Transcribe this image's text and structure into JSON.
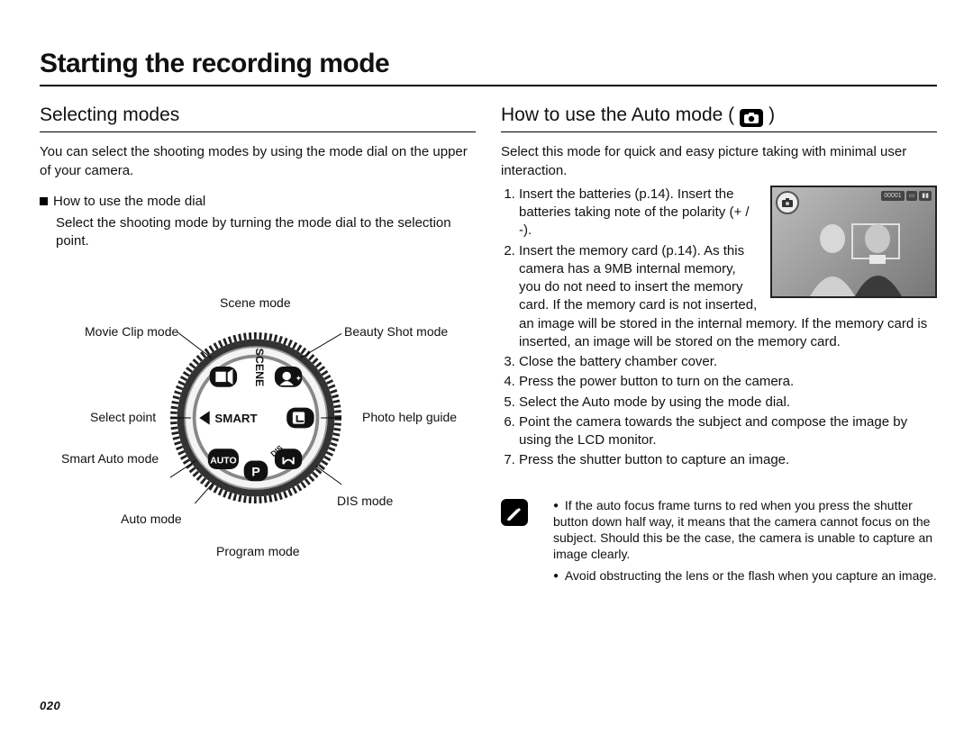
{
  "title": "Starting the recording mode",
  "pageNumber": "020",
  "left": {
    "heading": "Selecting modes",
    "intro": "You can select the shooting modes by using the mode dial on the upper of your camera.",
    "dialLabelTitle": "How to use the mode dial",
    "dialLabelBody": "Select the shooting mode by turning the mode dial to the selection point.",
    "labels": {
      "scene": "Scene mode",
      "movie": "Movie Clip mode",
      "beauty": "Beauty Shot mode",
      "select": "Select point",
      "photoHelp": "Photo help guide",
      "smart": "Smart Auto mode",
      "dis": "DIS mode",
      "auto": "Auto mode",
      "program": "Program mode"
    },
    "dialText": {
      "scene": "SCENE",
      "smart": "SMART",
      "auto": "AUTO",
      "dis": "DIS",
      "p": "P"
    }
  },
  "right": {
    "heading": "How to use the Auto mode (",
    "headingClose": ")",
    "intro": "Select this mode for quick and easy picture taking with minimal user interaction.",
    "steps": [
      "Insert the batteries (p.14). Insert the batteries taking note of the polarity (+ / -).",
      "Insert the memory card (p.14). As this camera has a 9MB internal memory, you do not need to insert the memory card. If the memory card is not inserted, an image will be stored in the internal memory. If the memory card is inserted, an image will be stored on the memory card.",
      "Close the battery chamber cover.",
      "Press the power button to turn on the camera.",
      "Select the Auto mode by using the mode dial.",
      "Point the camera towards the subject and compose the image by using the LCD monitor.",
      "Press the shutter button to capture an image."
    ],
    "notes": [
      "If the auto focus frame turns to red when you press the shutter button down half way, it means that the camera cannot focus on the subject. Should this be the case, the camera is unable to capture an image clearly.",
      "Avoid obstructing the lens or the flash when you capture an image."
    ],
    "preview": {
      "counter": "00001"
    }
  }
}
